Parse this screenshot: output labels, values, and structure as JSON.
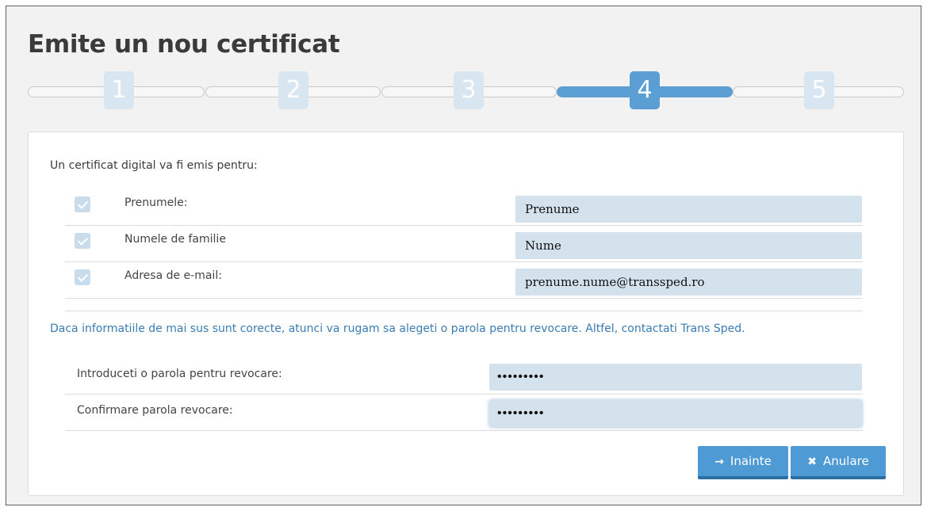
{
  "page": {
    "title": "Emite un nou certificat"
  },
  "stepper": {
    "steps": [
      "1",
      "2",
      "3",
      "4",
      "5"
    ],
    "active_step": 4
  },
  "form": {
    "intro": "Un certificat digital va fi emis pentru:",
    "fields": [
      {
        "label": "Prenumele:",
        "value": "Prenume",
        "checked": true
      },
      {
        "label": "Numele de familie",
        "value": "Nume",
        "checked": true
      },
      {
        "label": "Adresa de e-mail:",
        "value": "prenume.nume@transsped.ro",
        "checked": true
      }
    ],
    "notice": "Daca informatiile de mai sus sunt corecte, atunci va rugam sa alegeti o parola pentru revocare. Altfel, contactati Trans Sped.",
    "password": {
      "label": "Introduceti o parola pentru revocare:",
      "value": "•••••••••"
    },
    "confirm": {
      "label": "Confirmare parola revocare:",
      "value": "•••••••••"
    }
  },
  "buttons": {
    "next_label": "Inainte",
    "next_icon": "arrow-right-icon",
    "cancel_label": "Anulare",
    "cancel_icon": "close-icon"
  },
  "colors": {
    "accent": "#5b9ed3",
    "field_bg": "#d4e2ee",
    "notice_text": "#3a7cb2",
    "button": "#4d9ad5"
  }
}
